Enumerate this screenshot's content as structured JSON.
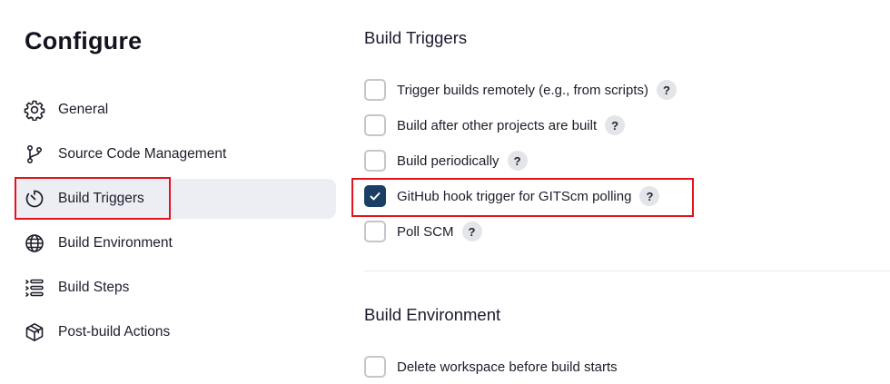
{
  "page": {
    "title": "Configure"
  },
  "sidebar": {
    "items": [
      {
        "label": "General",
        "icon": "gear-icon",
        "active": false
      },
      {
        "label": "Source Code Management",
        "icon": "git-branch-icon",
        "active": false
      },
      {
        "label": "Build Triggers",
        "icon": "timer-icon",
        "active": true
      },
      {
        "label": "Build Environment",
        "icon": "globe-icon",
        "active": false
      },
      {
        "label": "Build Steps",
        "icon": "list-steps-icon",
        "active": false
      },
      {
        "label": "Post-build Actions",
        "icon": "package-icon",
        "active": false
      }
    ]
  },
  "build_triggers": {
    "title": "Build Triggers",
    "options": [
      {
        "label": "Trigger builds remotely (e.g., from scripts)",
        "checked": false,
        "help": "?"
      },
      {
        "label": "Build after other projects are built",
        "checked": false,
        "help": "?"
      },
      {
        "label": "Build periodically",
        "checked": false,
        "help": "?"
      },
      {
        "label": "GitHub hook trigger for GITScm polling",
        "checked": true,
        "help": "?"
      },
      {
        "label": "Poll SCM",
        "checked": false,
        "help": "?"
      }
    ]
  },
  "build_environment": {
    "title": "Build Environment",
    "options": [
      {
        "label": "Delete workspace before build starts",
        "checked": false
      }
    ]
  },
  "colors": {
    "accent": "#1b3e64",
    "highlight": "#e3131d",
    "active_bg": "#eceef3"
  }
}
